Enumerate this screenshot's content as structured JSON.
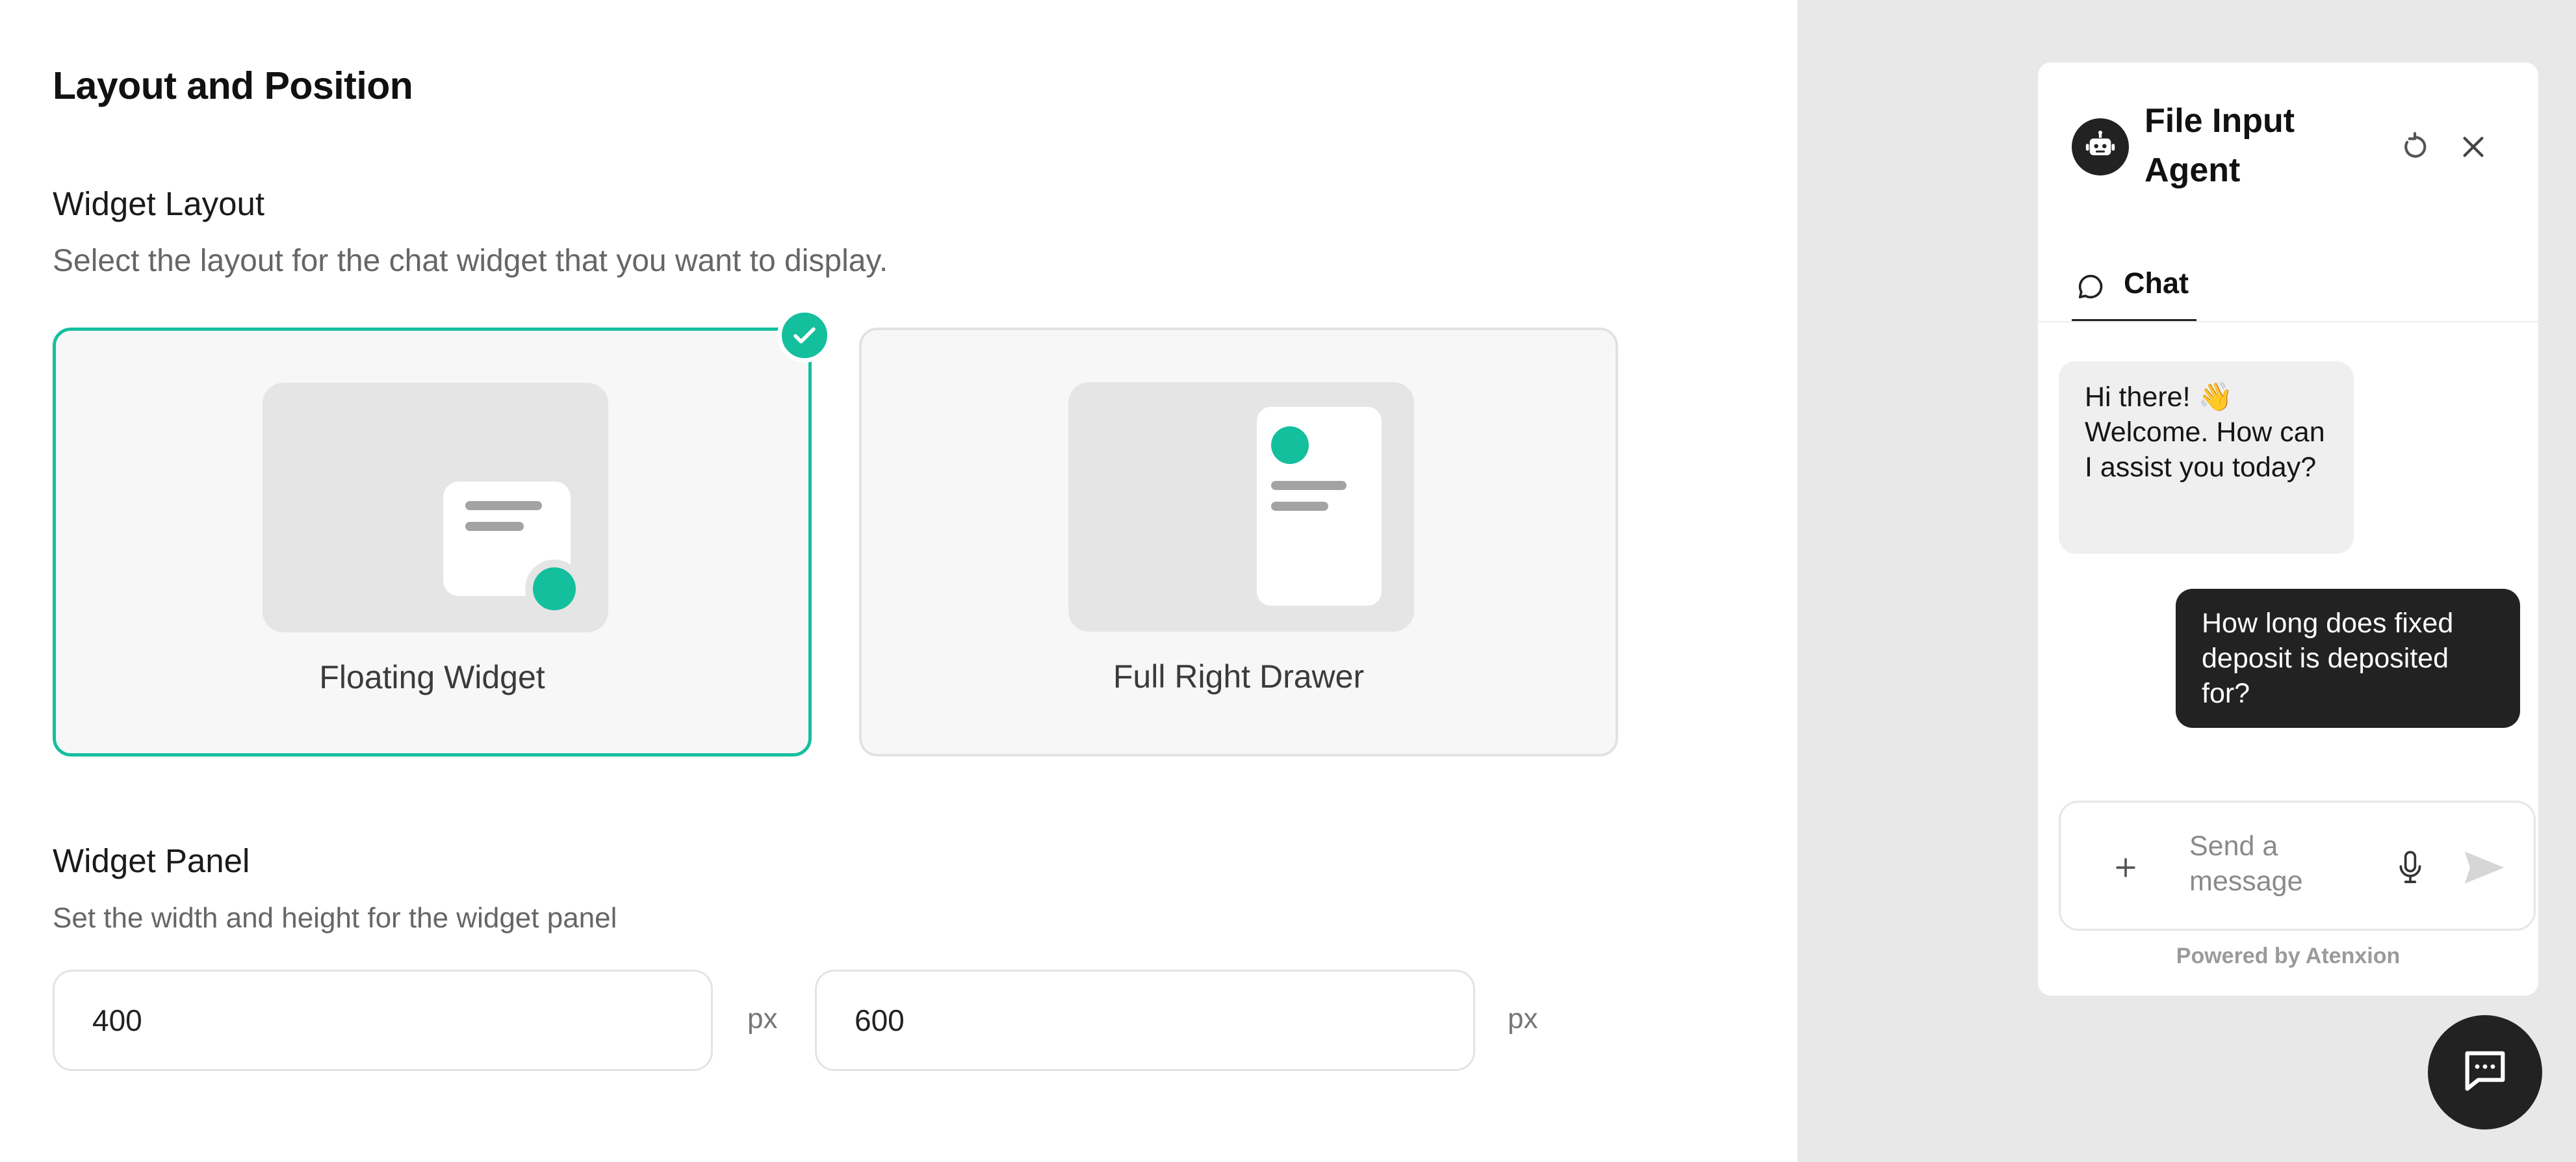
{
  "settings": {
    "section_title": "Layout and Position",
    "widget_layout": {
      "title": "Widget Layout",
      "description": "Select the layout for the chat widget that you want to display.",
      "options": [
        {
          "label": "Floating Widget",
          "selected": true
        },
        {
          "label": "Full Right Drawer",
          "selected": false
        }
      ]
    },
    "widget_panel": {
      "title": "Widget Panel",
      "description": "Set the width and height for the widget panel",
      "width_value": "400",
      "height_value": "600",
      "unit": "px"
    }
  },
  "chat_preview": {
    "agent_name": "File Input Agent",
    "tab_label": "Chat",
    "messages": [
      {
        "role": "bot",
        "text": "Hi there! 👋 Welcome. How can I assist you today?"
      },
      {
        "role": "user",
        "text": "How long does fixed deposit is deposited for?"
      }
    ],
    "input_placeholder": "Send a message",
    "powered_by": "Powered by Atenxion"
  },
  "icons": {
    "agent": "robot-icon",
    "refresh": "refresh-icon",
    "close": "close-icon",
    "tab": "chat-bubble-icon",
    "attach": "plus-icon",
    "mic": "microphone-icon",
    "send": "send-icon",
    "launcher": "message-square-icon",
    "check": "check-icon"
  },
  "colors": {
    "accent": "#14bf9e",
    "dark": "#222222",
    "preview_background": "#e8e8e8"
  }
}
